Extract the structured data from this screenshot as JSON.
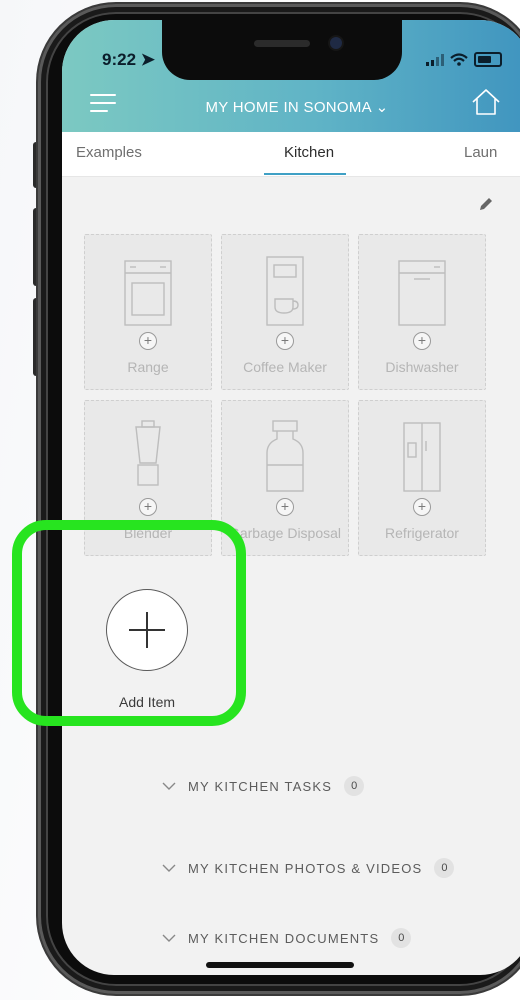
{
  "status_bar": {
    "time": "9:22",
    "location_icon": "location-arrow-icon",
    "signal_icon": "signal-icon",
    "wifi_icon": "wifi-icon",
    "battery_icon": "battery-icon"
  },
  "header": {
    "title": "MY HOME IN SONOMA",
    "menu_icon": "menu-icon",
    "home_icon": "home-icon",
    "accent_gradient": [
      "#7cc9c2",
      "#3f94bf"
    ]
  },
  "tabs": [
    {
      "label": "Examples",
      "active": false
    },
    {
      "label": "Kitchen",
      "active": true
    },
    {
      "label": "Laun",
      "active": false
    }
  ],
  "edit_icon": "pencil-icon",
  "appliances": [
    {
      "label": "Range",
      "icon": "range-icon"
    },
    {
      "label": "Coffee Maker",
      "icon": "coffee-maker-icon"
    },
    {
      "label": "Dishwasher",
      "icon": "dishwasher-icon"
    },
    {
      "label": "Blender",
      "icon": "blender-icon"
    },
    {
      "label": "Garbage Disposal",
      "icon": "garbage-disposal-icon"
    },
    {
      "label": "Refrigerator",
      "icon": "refrigerator-icon"
    }
  ],
  "add_item": {
    "label": "Add Item",
    "highlight_color": "#27e41f"
  },
  "sections": [
    {
      "title": "MY KITCHEN TASKS",
      "count": "0"
    },
    {
      "title": "MY KITCHEN PHOTOS & VIDEOS",
      "count": "0"
    },
    {
      "title": "MY KITCHEN DOCUMENTS",
      "count": "0"
    }
  ]
}
